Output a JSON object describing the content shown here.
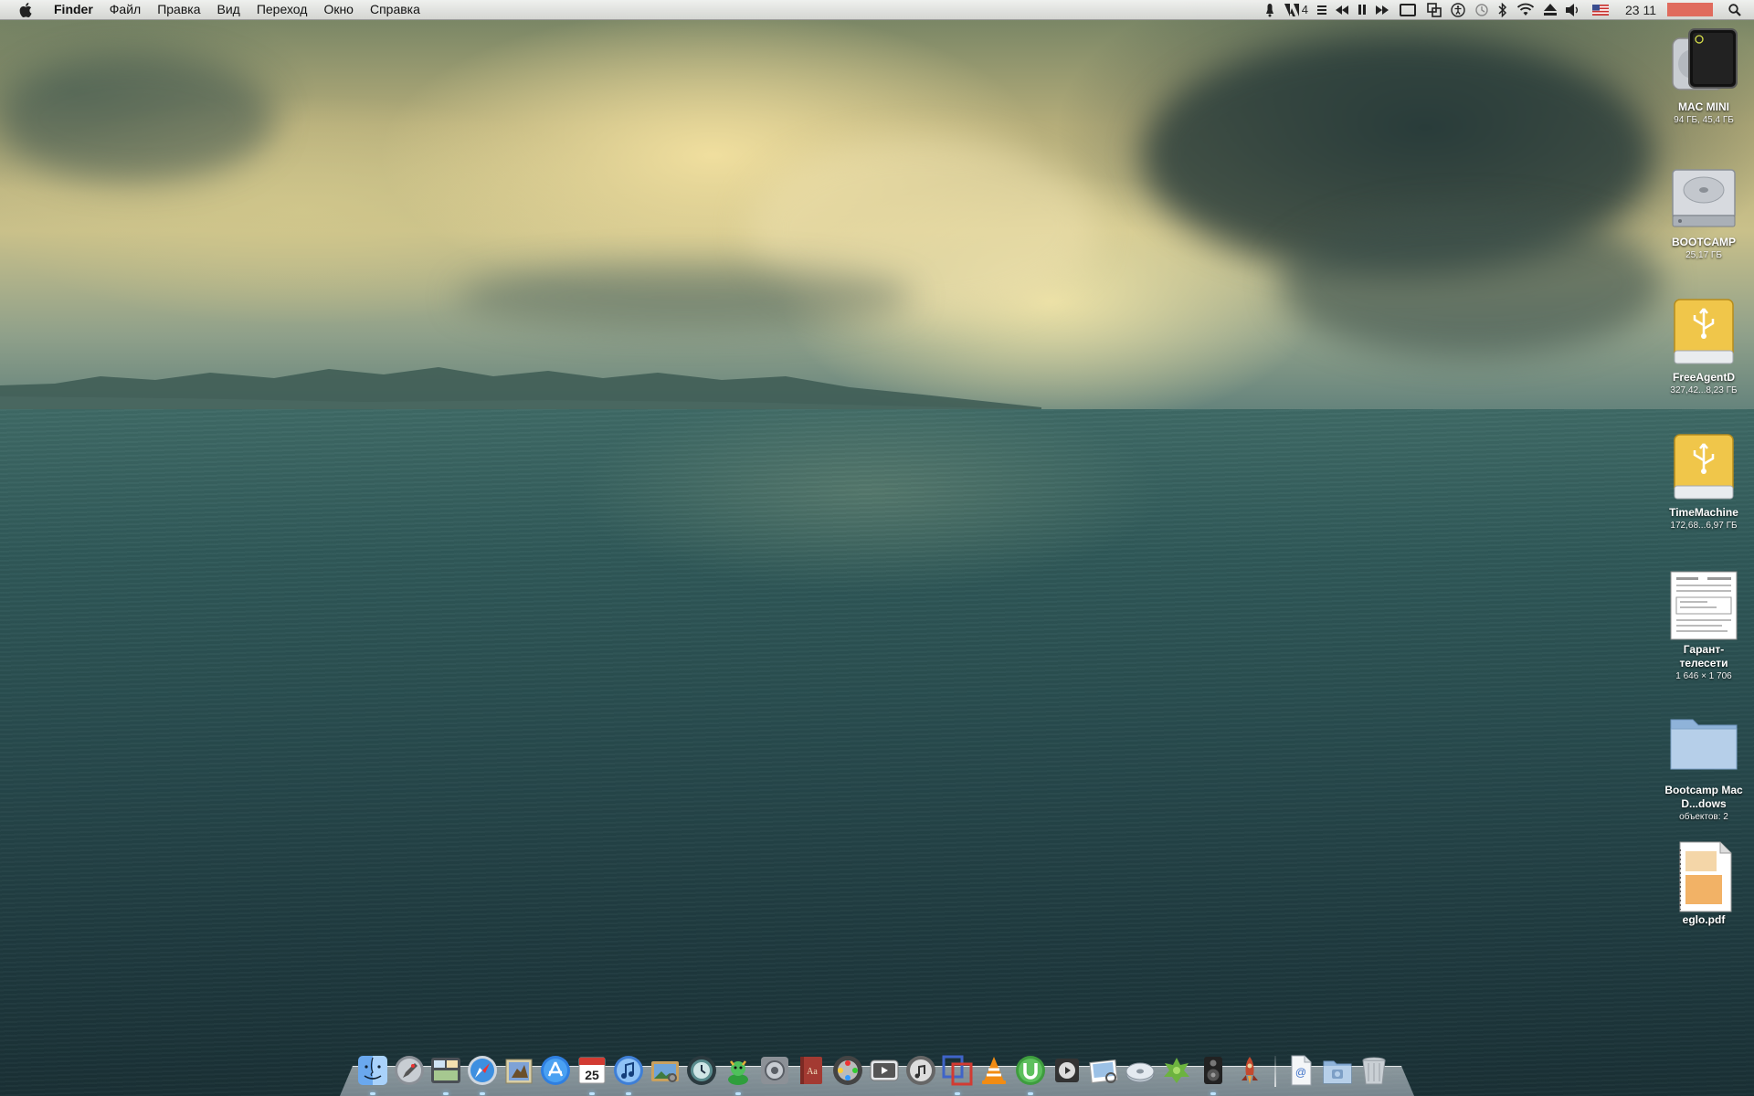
{
  "menubar": {
    "app_name": "Finder",
    "menus": [
      "Файл",
      "Правка",
      "Вид",
      "Переход",
      "Окно",
      "Справка"
    ],
    "adobe_count": "4",
    "clock": "23 11",
    "input_language": "us-flag",
    "status_icons": [
      "notification-icon",
      "adobe-icon",
      "list-icon",
      "rewind-icon",
      "pause-icon",
      "fast-forward-icon",
      "display-icon",
      "spaces-icon",
      "accessibility-icon",
      "time-machine-icon",
      "bluetooth-icon",
      "wifi-icon",
      "eject-icon",
      "volume-icon",
      "us-flag-icon",
      "battery-icon",
      "spotlight-icon"
    ]
  },
  "desktop": {
    "icons": [
      {
        "name": "MAC MINI",
        "info": "94 ГБ, 45,4 ГБ",
        "type": "internal-drive"
      },
      {
        "name": "BOOTCAMP",
        "info": "25,17 ГБ",
        "type": "hard-disk"
      },
      {
        "name": "FreeAgentD",
        "info": "327,42...8,23 ГБ",
        "type": "usb-drive"
      },
      {
        "name": "TimeMachine",
        "info": "172,68...6,97 ГБ",
        "type": "usb-drive"
      },
      {
        "name": "Гарант-телесети",
        "info": "1 646 × 1 706",
        "type": "document-image"
      },
      {
        "name": "Bootcamp Mac D...dows",
        "info": "объектов: 2",
        "type": "folder"
      },
      {
        "name": "eglo.pdf",
        "info": "",
        "type": "pdf"
      }
    ]
  },
  "dock": {
    "apps": [
      "finder",
      "launchpad",
      "mission-control",
      "safari",
      "mail",
      "app-store",
      "calendar",
      "itunes",
      "iphoto",
      "time-machine",
      "adium",
      "system-preferences",
      "dictionary",
      "dvd-player",
      "front-row",
      "ipod-utility",
      "parallels",
      "vlc",
      "utorrent",
      "quicktime",
      "preview",
      "disk-utility",
      "evernote",
      "speakers",
      "rocket"
    ],
    "calendar_day": "25",
    "right_items": [
      "url-file",
      "screenshots-folder",
      "trash"
    ],
    "colors": {
      "indicator": "#bde3ff"
    }
  }
}
